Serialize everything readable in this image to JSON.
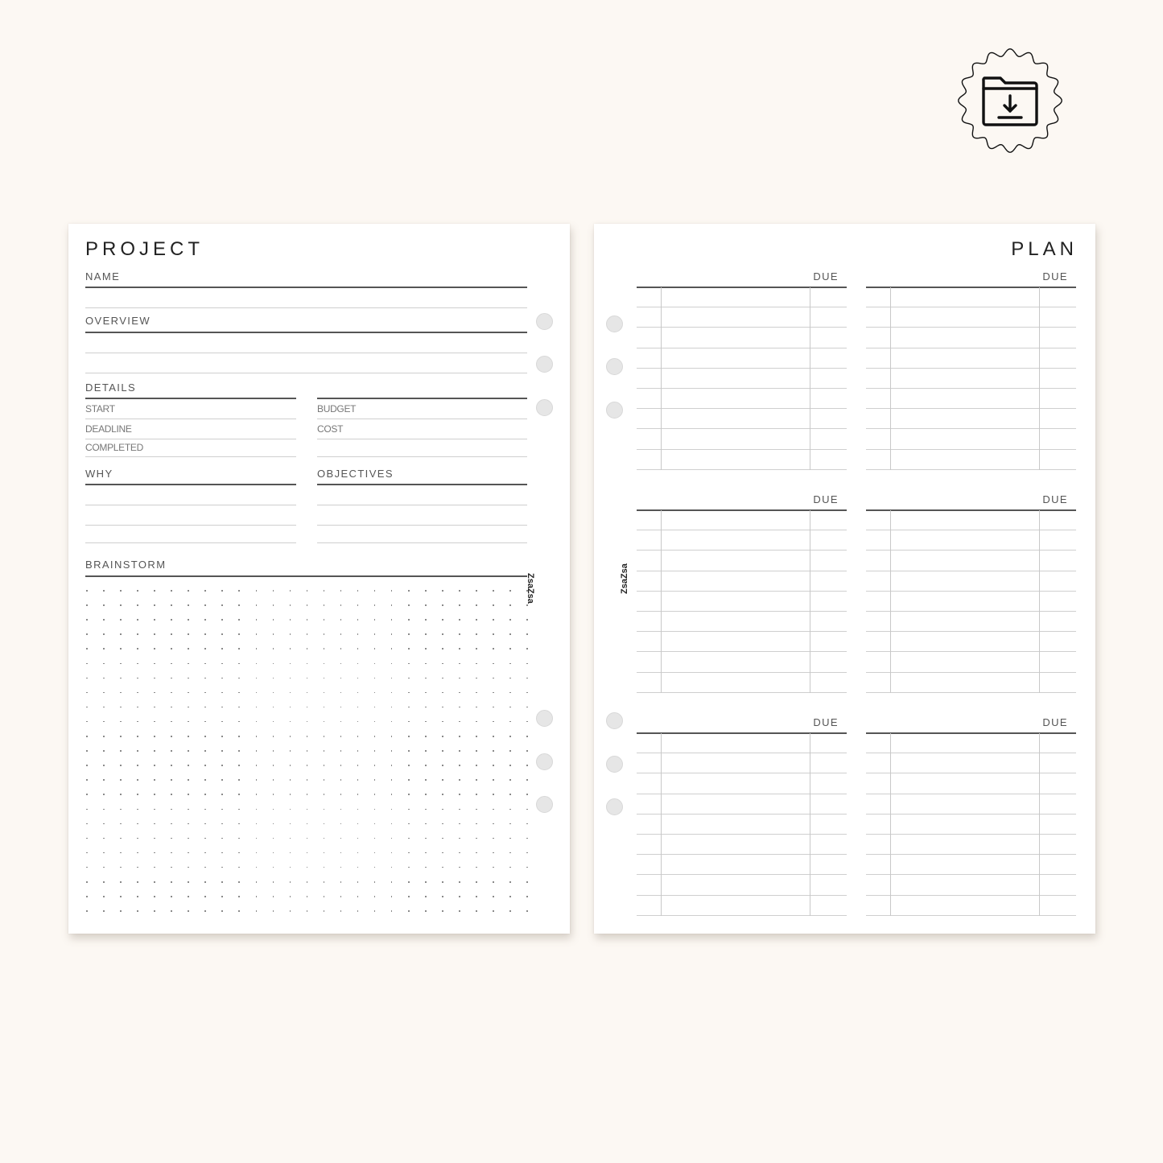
{
  "download_badge": {
    "icon": "folder-download-icon"
  },
  "left_page": {
    "title": "PROJECT",
    "sections": {
      "name": "NAME",
      "overview": "OVERVIEW",
      "details": "DETAILS",
      "why": "WHY",
      "objectives": "OBJECTIVES",
      "brainstorm": "BRAINSTORM"
    },
    "details_left": [
      "START",
      "DEADLINE",
      "COMPLETED"
    ],
    "details_right": [
      "BUDGET",
      "COST"
    ],
    "brand": "ZsaZsa"
  },
  "right_page": {
    "title": "PLAN",
    "due_label": "DUE",
    "blocks": [
      {
        "due": "DUE"
      },
      {
        "due": "DUE"
      },
      {
        "due": "DUE"
      },
      {
        "due": "DUE"
      },
      {
        "due": "DUE"
      },
      {
        "due": "DUE"
      }
    ],
    "brand": "ZsaZsa"
  }
}
